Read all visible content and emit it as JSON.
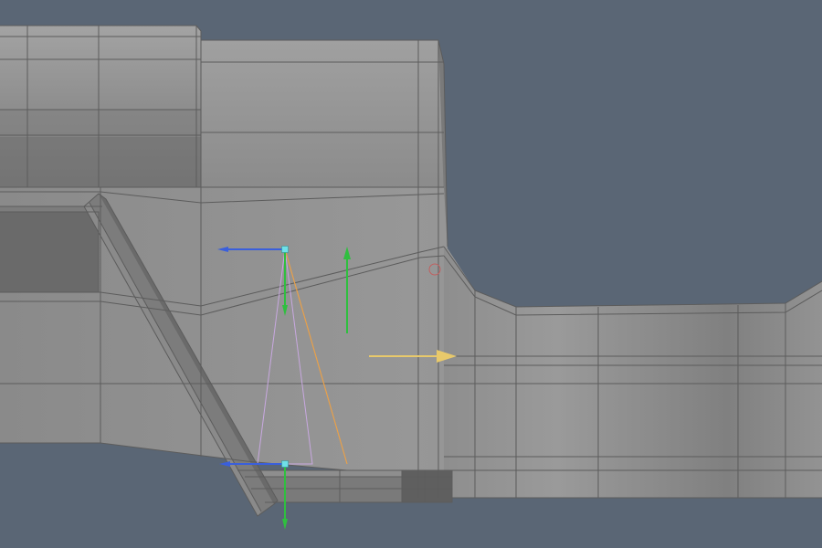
{
  "viewport": {
    "background": "#5a6675",
    "mesh_light": "#9c9c9c",
    "mesh_mid": "#8f8f8f",
    "mesh_dark": "#6a6a6a",
    "wire": "#5c5c5c"
  },
  "gizmos": {
    "axis_x_color": "#e8c96b",
    "axis_y_color": "#2fbf3f",
    "axis_z_color": "#3a5fdc",
    "spline_color": "#e8a04a",
    "guide_color": "#c8a8e0",
    "handle_color": "#6fe0e8",
    "pivot_color": "#c06060"
  }
}
